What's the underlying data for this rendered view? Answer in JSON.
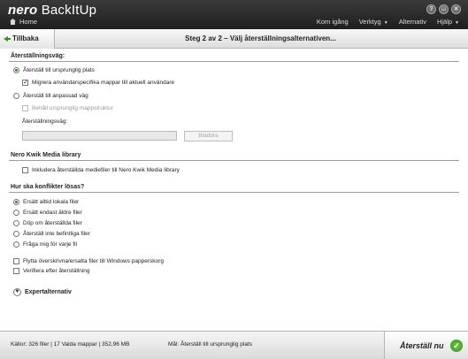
{
  "app": {
    "brand_bold": "nero",
    "brand_name": "BackItUp",
    "home_label": "Home",
    "window_buttons": [
      "?",
      "□",
      "✕"
    ]
  },
  "menu": {
    "items": [
      "Kom igång",
      "Verktyg",
      "Alternativ",
      "Hjälp"
    ],
    "dropdown_caret": "▼"
  },
  "nav": {
    "back_label": "Tillbaka",
    "step_title": "Steg 2 av 2 – Välj återställningsalternativen..."
  },
  "restore_path": {
    "title": "Återställningsväg:",
    "options": [
      {
        "label": "Återställ till ursprunglig plats",
        "selected": true
      },
      {
        "label": "Återställ till anpassad väg",
        "selected": false
      }
    ],
    "migrate_label": "Migrera användarspecifika mappar till aktuell användare",
    "migrate_checked": true,
    "keep_structure_label": "Behåll ursprunglig mappstruktur",
    "path_label": "Återställningsväg:",
    "path_value": "",
    "browse_label": "Bläddra"
  },
  "kwik": {
    "title": "Nero Kwik Media library",
    "include_label": "Inkludera återställda mediefiler till Nero Kwik Media library"
  },
  "conflicts": {
    "title": "Hur ska konflikter lösas?",
    "options": [
      {
        "label": "Ersätt alltid lokala filer",
        "selected": true
      },
      {
        "label": "Ersätt endast äldre filer",
        "selected": false
      },
      {
        "label": "Döp om återställda filer",
        "selected": false
      },
      {
        "label": "Återställ inte befintliga filer",
        "selected": false
      },
      {
        "label": "Fråga mig för varje fil",
        "selected": false
      }
    ],
    "checkboxes": [
      {
        "label": "Flytta överskrivna/ersatta filer till Windows papperskorg",
        "checked": false
      },
      {
        "label": "Verifiera efter återställning",
        "checked": false
      }
    ]
  },
  "expert_label": "Expertalternativ",
  "status": {
    "files": "Källor: 326 filer | 17 Valda mappar | 352,96 MB",
    "target": "Mål: Återställ till ursprunglig plats",
    "restore_button": "Återställ nu"
  },
  "colors": {
    "accent": "#2f8a1a",
    "titlebar": "#2a2a2a"
  }
}
